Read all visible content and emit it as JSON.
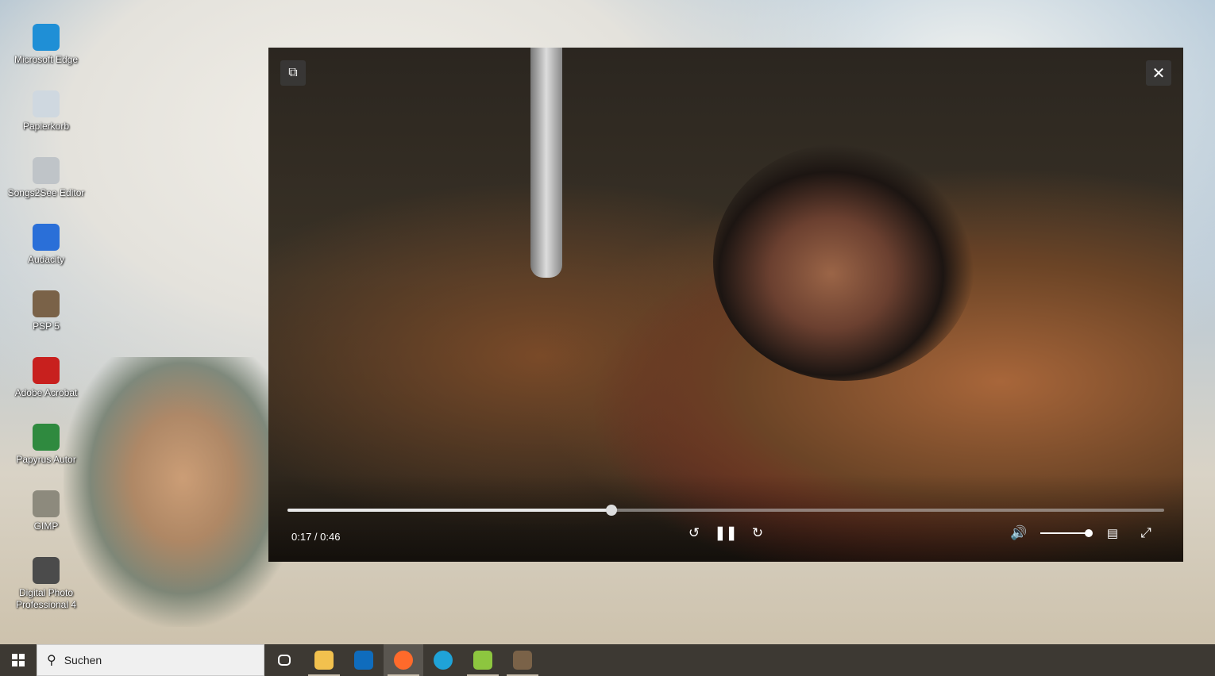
{
  "desktop": {
    "icons": [
      {
        "label": "Microsoft Edge",
        "color": "#1f8fd6"
      },
      {
        "label": "Papierkorb",
        "color": "#cfd8e0"
      },
      {
        "label": "Songs2See Editor",
        "color": "#bfc4c8"
      },
      {
        "label": "Audacity",
        "color": "#2a6fd8"
      },
      {
        "label": "PSP 5",
        "color": "#7a6248"
      },
      {
        "label": "Adobe Acrobat",
        "color": "#c8201e"
      },
      {
        "label": "Papyrus Autor",
        "color": "#2f8a3f"
      },
      {
        "label": "GIMP",
        "color": "#8d8a7d"
      },
      {
        "label": "Digital Photo Professional 4",
        "color": "#4b4b4b"
      }
    ]
  },
  "player": {
    "time": "0:17 / 0:46",
    "progress_fraction": 0.37,
    "volume_fraction": 1.0,
    "state": "playing",
    "icons": {
      "mini": "picture-in-picture-icon",
      "close": "close-icon",
      "rewind": "replay-5-icon",
      "pause": "pause-icon",
      "forward": "forward-5-icon",
      "volume": "volume-icon",
      "captions": "captions-icon",
      "fullscreen": "fullscreen-icon"
    }
  },
  "taskbar": {
    "search_placeholder": "Suchen",
    "apps": [
      {
        "name": "task-view",
        "color": "#ffffff"
      },
      {
        "name": "file-explorer",
        "color": "#f2c14e",
        "running": true
      },
      {
        "name": "outlook",
        "color": "#0f6cbd"
      },
      {
        "name": "firefox",
        "color": "#ff6a2b",
        "running": true,
        "active": true
      },
      {
        "name": "edge",
        "color": "#1fa3d8"
      },
      {
        "name": "notepad",
        "color": "#8dc63f",
        "running": true
      },
      {
        "name": "psp",
        "color": "#7a6248",
        "running": true
      }
    ]
  }
}
